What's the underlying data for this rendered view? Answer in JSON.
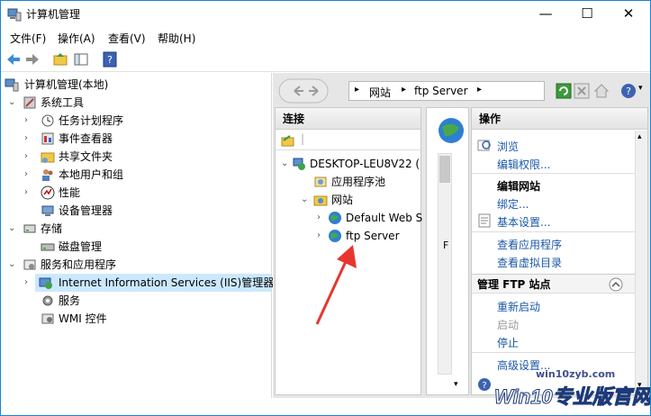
{
  "window": {
    "title": "计算机管理"
  },
  "menu": [
    "文件(F)",
    "操作(A)",
    "查看(V)",
    "帮助(H)"
  ],
  "tree": {
    "root": "计算机管理(本地)",
    "system_tools": "系统工具",
    "task_scheduler": "任务计划程序",
    "event_viewer": "事件查看器",
    "shared_folders": "共享文件夹",
    "local_users": "本地用户和组",
    "performance": "性能",
    "device_manager": "设备管理器",
    "storage": "存储",
    "disk_management": "磁盘管理",
    "services_apps": "服务和应用程序",
    "iis": "Internet Information Services (IIS)管理器",
    "services": "服务",
    "wmi": "WMI 控件"
  },
  "address": {
    "seg1": "网站",
    "seg2": "ftp Server"
  },
  "connections": {
    "header": "连接",
    "server": "DESKTOP-LEU8V22 (",
    "app_pools": "应用程序池",
    "sites": "网站",
    "default_site": "Default Web S",
    "ftp_site": "ftp Server"
  },
  "middle": {
    "partial_text": "F"
  },
  "actions": {
    "header": "操作",
    "browse": "浏览",
    "edit_perm": "编辑权限...",
    "edit_site_title": "编辑网站",
    "bindings": "绑定...",
    "basic_settings": "基本设置...",
    "view_apps": "查看应用程序",
    "view_vdirs": "查看虚拟目录",
    "ftp_manage": "管理 FTP 站点",
    "restart": "重新启动",
    "start": "启动",
    "stop": "停止",
    "advanced": "高级设置..."
  },
  "watermark": "Win10专业版官网",
  "watermark_url": "win10zyb.com",
  "colors": {
    "accent": "#1883d7",
    "link": "#1a57a8",
    "selection": "#cce8ff",
    "arrow": "#e8362f"
  }
}
